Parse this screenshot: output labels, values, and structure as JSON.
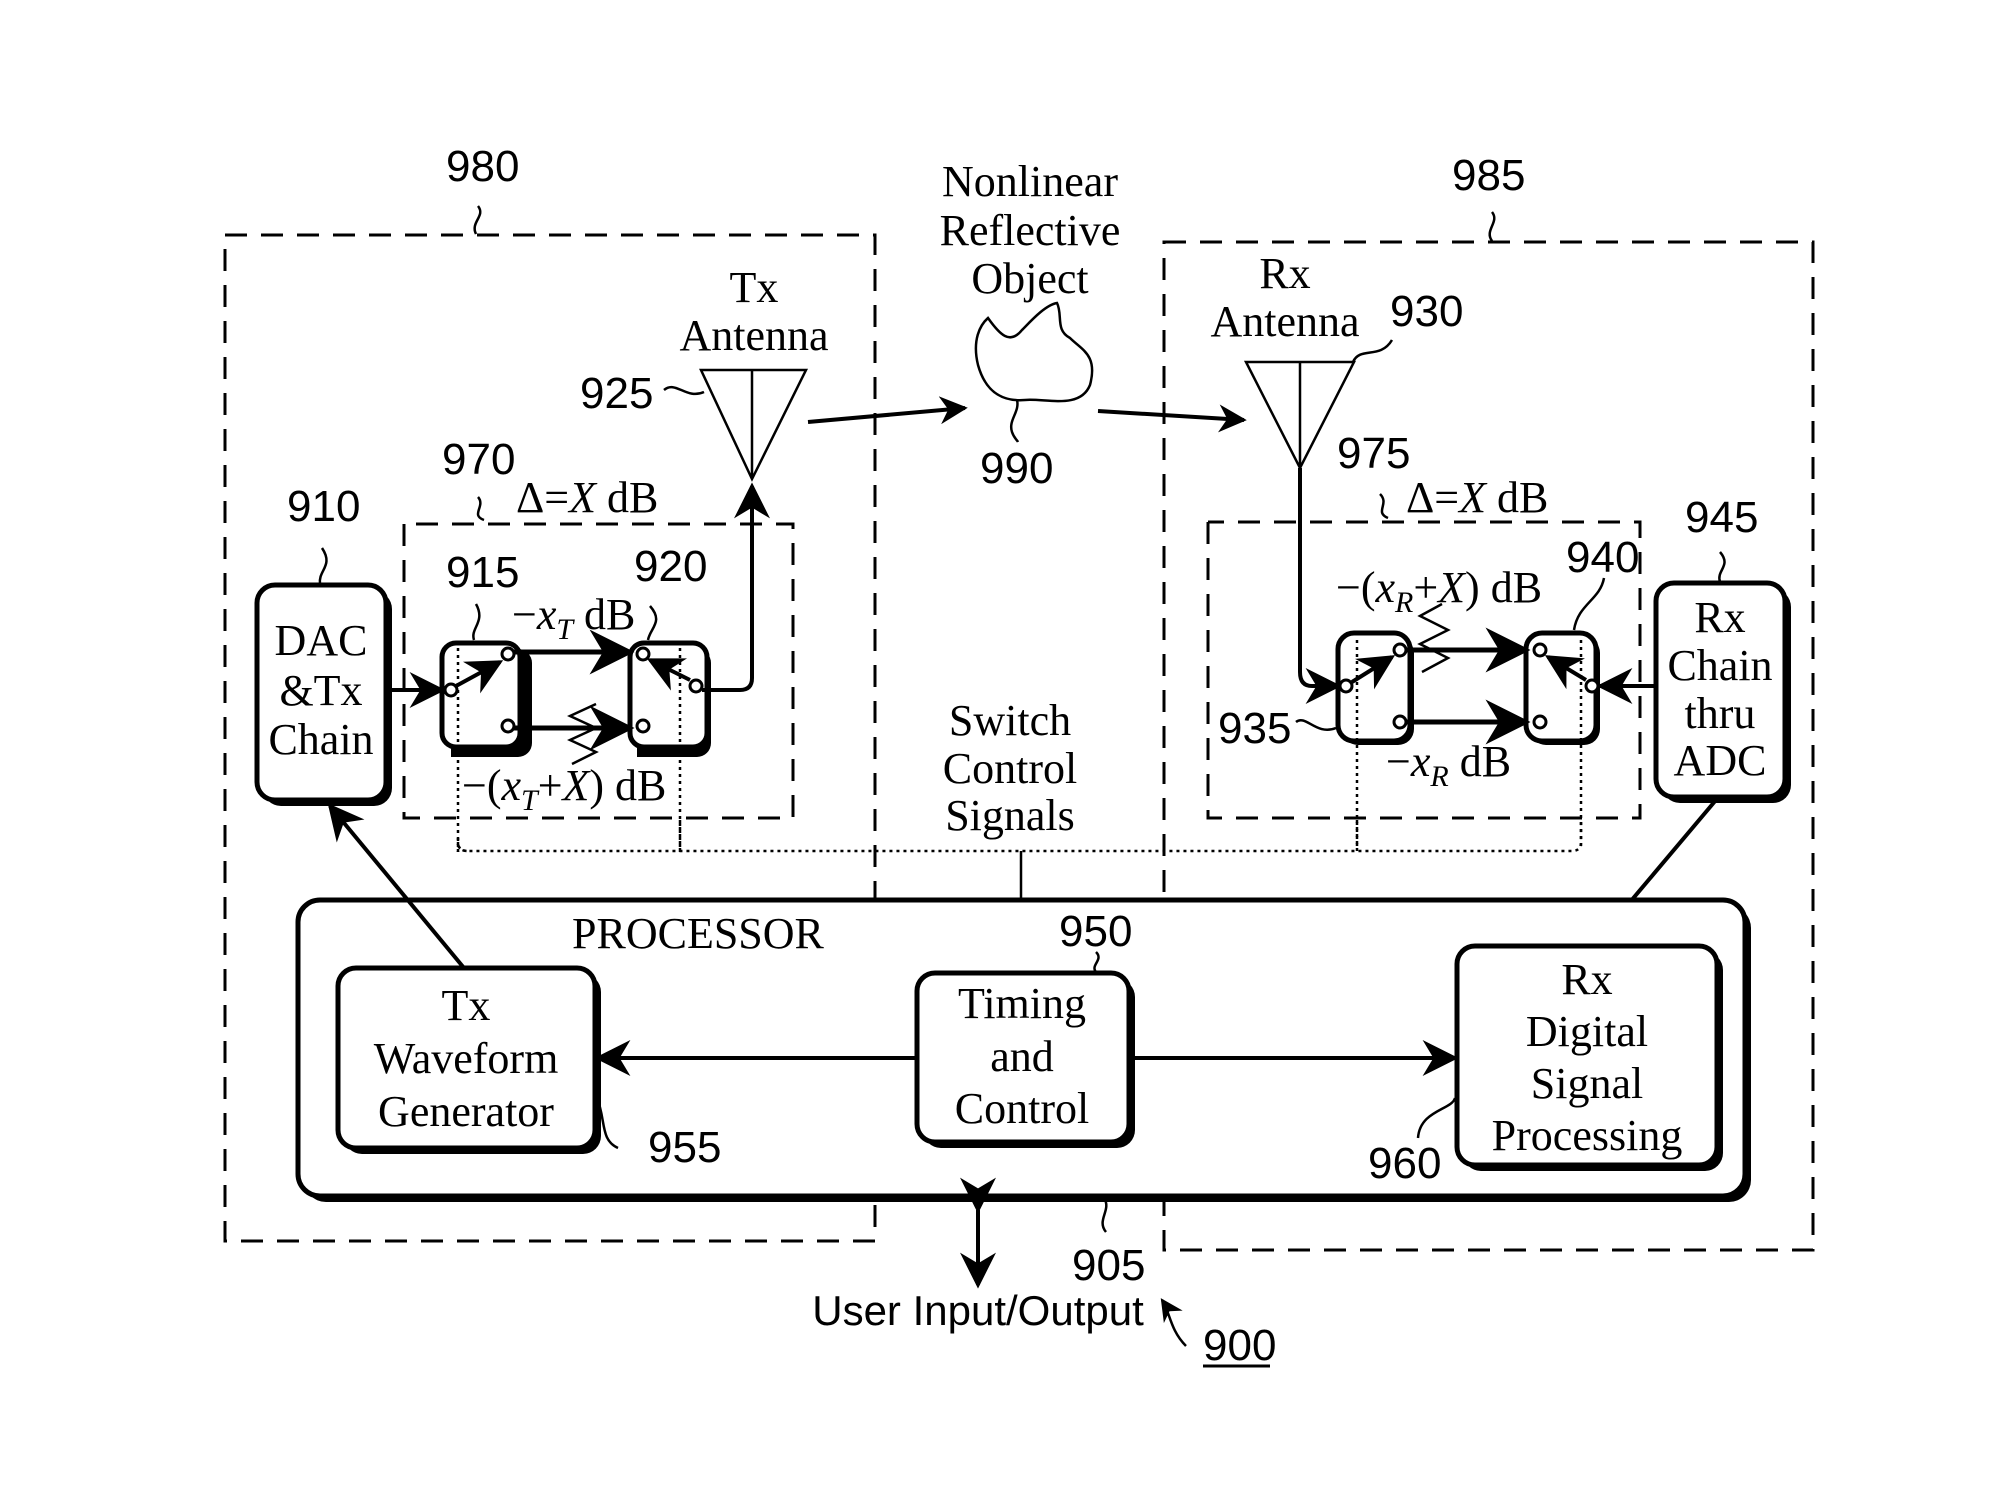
{
  "figure": {
    "number": "900",
    "regions": {
      "tx_region": {
        "ref": "980"
      },
      "rx_region": {
        "ref": "985"
      }
    },
    "target": {
      "lines": [
        "Nonlinear",
        "Reflective",
        "Object"
      ],
      "ref": "990"
    },
    "tx_antenna": {
      "lines": [
        "Tx",
        "Antenna"
      ],
      "ref": "925"
    },
    "rx_antenna": {
      "lines": [
        "Rx",
        "Antenna"
      ],
      "ref": "930"
    },
    "tx_attenuator": {
      "ref": "970",
      "delta_label": "Δ=X dB",
      "delta_prefix": "Δ=",
      "delta_var": "X",
      "delta_suffix": " dB",
      "switch_in": {
        "ref": "915"
      },
      "switch_out": {
        "ref": "920"
      },
      "upper_path": {
        "prefix": "−",
        "var": "x",
        "sub": "T",
        "suffix": " dB"
      },
      "lower_path": {
        "prefix": "−(",
        "var": "x",
        "sub": "T",
        "mid": "+",
        "var2": "X",
        "suffix": ") dB"
      }
    },
    "rx_attenuator": {
      "ref": "975",
      "delta_prefix": "Δ=",
      "delta_var": "X",
      "delta_suffix": " dB",
      "switch_in": {
        "ref": "935"
      },
      "switch_out": {
        "ref": "940"
      },
      "upper_path": {
        "prefix": "−(",
        "var": "x",
        "sub": "R",
        "mid": "+",
        "var2": "X",
        "suffix": ") dB"
      },
      "lower_path": {
        "prefix": "−",
        "var": "x",
        "sub": "R",
        "suffix": " dB"
      }
    },
    "dac_block": {
      "lines": [
        "DAC",
        "&Tx",
        "Chain"
      ],
      "ref": "910"
    },
    "rx_chain_block": {
      "lines": [
        "Rx",
        "Chain",
        "thru",
        "ADC"
      ],
      "ref": "945"
    },
    "switch_control": {
      "lines": [
        "Switch",
        "Control",
        "Signals"
      ]
    },
    "processor": {
      "label": "PROCESSOR",
      "ref": "905",
      "tx_waveform": {
        "lines": [
          "Tx",
          "Waveform",
          "Generator"
        ],
        "ref": "955"
      },
      "timing": {
        "lines": [
          "Timing",
          "and",
          "Control"
        ],
        "ref": "950"
      },
      "rx_dsp": {
        "lines": [
          "Rx",
          "Digital",
          "Signal",
          "Processing"
        ],
        "ref": "960"
      }
    },
    "user_io": {
      "label": "User Input/Output"
    }
  }
}
